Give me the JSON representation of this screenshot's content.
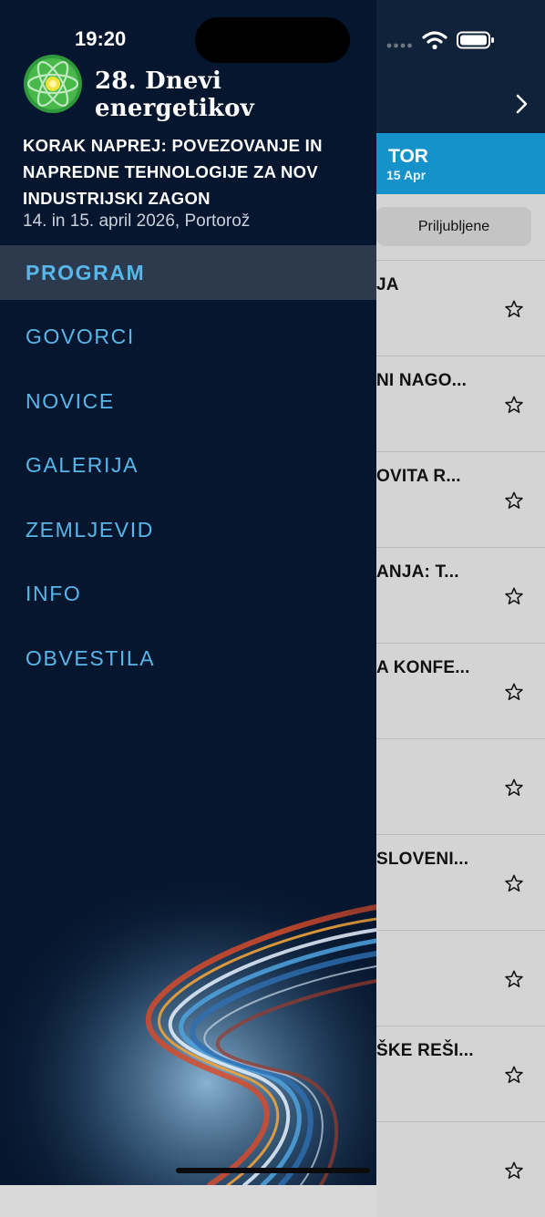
{
  "status_bar": {
    "time": "19:20",
    "icons": [
      "signal-icon",
      "wifi-icon",
      "battery-icon"
    ]
  },
  "drawer": {
    "brand_title": "28. Dnevi energetikov",
    "event": {
      "headline": "KORAK NAPREJ: POVEZOVANJE IN NAPREDNE TEHNOLOGIJE ZA NOV INDUSTRIJSKI ZAGON",
      "dates": "14. in 15. april 2026, Portorož"
    },
    "menu": [
      {
        "label": "PROGRAM",
        "active": true
      },
      {
        "label": "GOVORCI",
        "active": false
      },
      {
        "label": "NOVICE",
        "active": false
      },
      {
        "label": "GALERIJA",
        "active": false
      },
      {
        "label": "ZEMLJEVID",
        "active": false
      },
      {
        "label": "INFO",
        "active": false
      },
      {
        "label": "OBVESTILA",
        "active": false
      }
    ]
  },
  "background_screen": {
    "day_tab": {
      "label": "TOR",
      "date": "15 Apr"
    },
    "favorites_label": "Priljubljene",
    "sessions": [
      {
        "title": "JA"
      },
      {
        "title": "NI NAGO..."
      },
      {
        "title": "OVITA R..."
      },
      {
        "title": "ANJA: T..."
      },
      {
        "title": "A KONFE..."
      },
      {
        "title": ""
      },
      {
        "title": "SLOVENI..."
      },
      {
        "title": ""
      },
      {
        "title": "ŠKE REŠI..."
      },
      {
        "title": ""
      }
    ]
  },
  "colors": {
    "drawer_bg": "#06162e",
    "menu_text": "#58b7ea",
    "active_item_bg": "#2d3a4d",
    "day_tab_bg": "#1592c9",
    "header_bg": "#0f2239"
  }
}
